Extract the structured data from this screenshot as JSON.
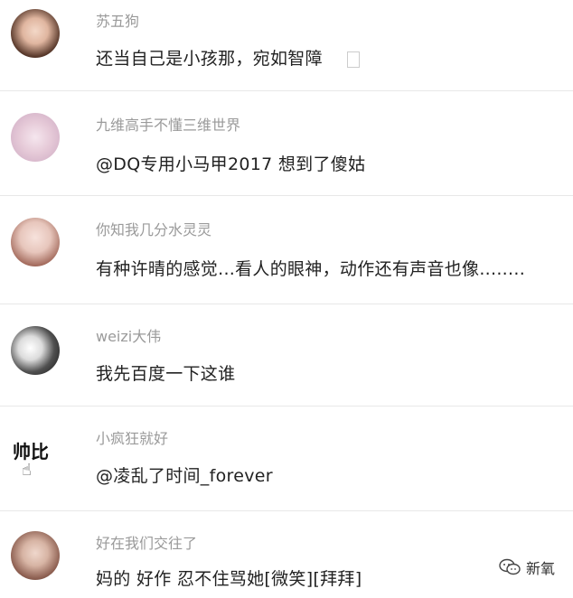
{
  "comments": [
    {
      "username": "苏五狗",
      "text": "还当自己是小孩那，宛如智障"
    },
    {
      "username": "九维高手不懂三维世界",
      "text": "@DQ专用小马甲2017 想到了傻姑"
    },
    {
      "username": "你知我几分水灵灵",
      "text": "有种许晴的感觉...看人的眼神，动作还有声音也像........"
    },
    {
      "username": "weizi大伟",
      "text": "我先百度一下这谁"
    },
    {
      "username": "小疯狂就好",
      "text": "@凌乱了时间_forever",
      "avatar_text": "帅比"
    },
    {
      "username": "好在我们交往了",
      "text": "妈的 好作 忍不住骂她[微笑][拜拜]"
    }
  ],
  "watermark": {
    "label": "新氧",
    "icon": "wechat-icon"
  },
  "colors": {
    "username": "#9a9a9a",
    "text": "#222222",
    "divider": "#e8e8e8"
  }
}
